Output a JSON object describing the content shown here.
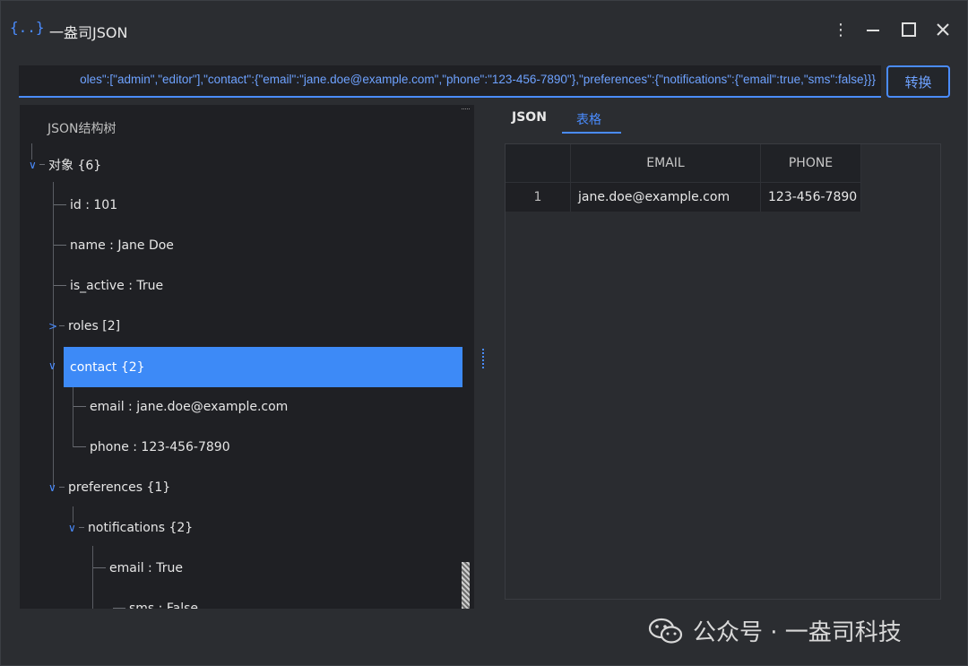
{
  "app": {
    "icon_text": "{..}",
    "title": "一盎司JSON"
  },
  "input": {
    "value": "oles\":[\"admin\",\"editor\"],\"contact\":{\"email\":\"jane.doe@example.com\",\"phone\":\"123-456-7890\"},\"preferences\":{\"notifications\":{\"email\":true,\"sms\":false}}}"
  },
  "convert_label": "转换",
  "tree": {
    "header": "JSON结构树",
    "nodes": [
      {
        "label": "对象 {6}",
        "chev": "∨"
      },
      {
        "label": "id : 101"
      },
      {
        "label": "name : Jane Doe"
      },
      {
        "label": "is_active : True"
      },
      {
        "label": "roles [2]",
        "chev": ">"
      },
      {
        "label": "contact {2}",
        "chev": "∨"
      },
      {
        "label": "email : jane.doe@example.com"
      },
      {
        "label": "phone : 123-456-7890"
      },
      {
        "label": "preferences {1}",
        "chev": "∨"
      },
      {
        "label": "notifications {2}",
        "chev": "∨"
      },
      {
        "label": "email : True"
      },
      {
        "label": "sms : False"
      }
    ]
  },
  "tabs": [
    {
      "label": "JSON"
    },
    {
      "label": "表格"
    }
  ],
  "table": {
    "columns": [
      "",
      "EMAIL",
      "PHONE"
    ],
    "rows": [
      [
        "1",
        "jane.doe@example.com",
        "123-456-7890"
      ]
    ]
  },
  "watermark": "公众号 · 一盎司科技",
  "colors": {
    "accent": "#4a8cff",
    "selected": "#3d8af7",
    "background": "#2b2d31",
    "panel": "#1f2024"
  }
}
